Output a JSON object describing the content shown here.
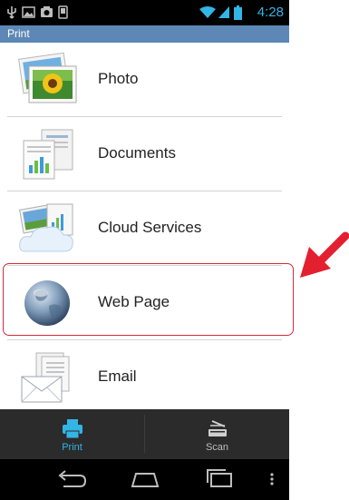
{
  "status_bar": {
    "time": "4:28"
  },
  "title_bar": {
    "title": "Print"
  },
  "menu": {
    "items": [
      {
        "label": "Photo",
        "icon": "photo-icon"
      },
      {
        "label": "Documents",
        "icon": "documents-icon"
      },
      {
        "label": "Cloud Services",
        "icon": "cloud-services-icon"
      },
      {
        "label": "Web Page",
        "icon": "globe-icon"
      },
      {
        "label": "Email",
        "icon": "email-icon"
      }
    ]
  },
  "tab_bar": {
    "tabs": [
      {
        "label": "Print",
        "icon": "printer-icon"
      },
      {
        "label": "Scan",
        "icon": "scanner-icon"
      }
    ]
  },
  "colors": {
    "accent": "#33b5e5",
    "title_bar": "#5d88b5",
    "highlight": "#d32a3a"
  }
}
